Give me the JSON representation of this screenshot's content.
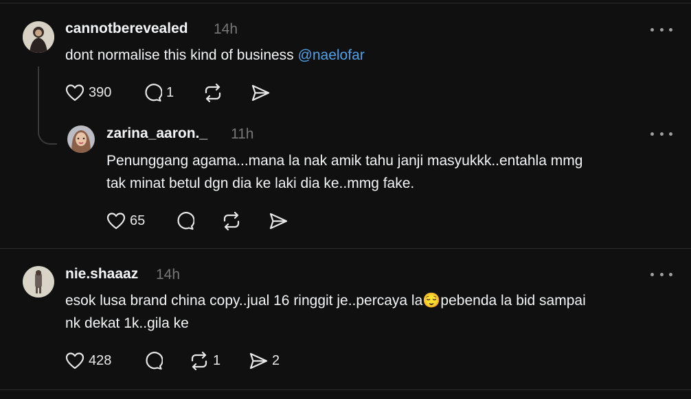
{
  "comments": [
    {
      "username": "cannotberevealed",
      "time": "14h",
      "text": "dont normalise this kind of business",
      "mention": "@naelofar",
      "likes": "390",
      "replies": "1",
      "reposts": "",
      "shares": "",
      "icons": [
        "heart-icon",
        "comment-icon",
        "repost-icon",
        "share-icon",
        "more-icon"
      ]
    },
    {
      "username": "zarina_aaron._",
      "time": "11h",
      "text_line1": "Penunggang agama...mana la nak amik tahu janji masyukkk..entahla mmg",
      "text_line2": "tak minat betul dgn dia ke laki dia ke..mmg fake.",
      "likes": "65",
      "replies": "",
      "reposts": "",
      "shares": ""
    },
    {
      "username": "nie.shaaaz",
      "time": "14h",
      "text_line1a": "esok lusa brand china copy..jual 16 ringgit je..percaya la",
      "emoji": "😌",
      "text_line1b": "pebenda la bid sampai",
      "text_line2": "nk dekat 1k..gila ke",
      "likes": "428",
      "replies": "",
      "reposts": "1",
      "shares": "2"
    }
  ],
  "colors": {
    "background": "#101010",
    "text": "#f3f5f7",
    "muted": "#777777",
    "mention": "#4ea2ea",
    "divider": "#2c2c2c"
  }
}
